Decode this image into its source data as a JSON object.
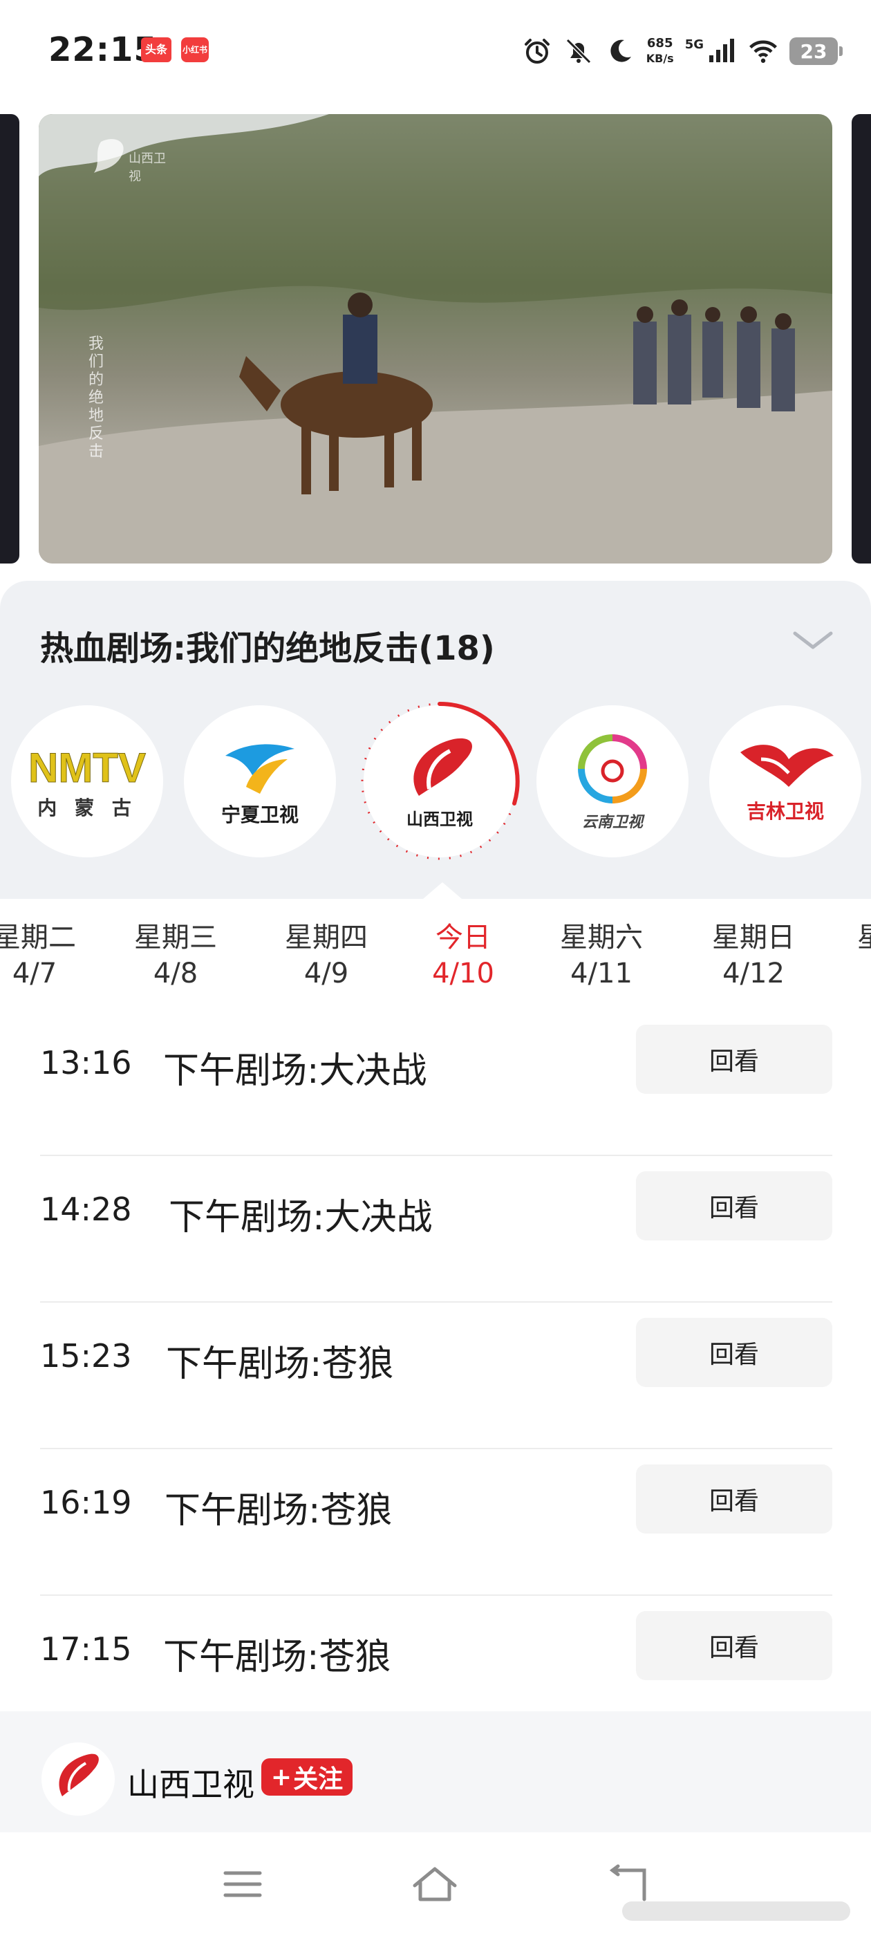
{
  "status_bar": {
    "time": "22:15",
    "badges": [
      "头条",
      "小红书"
    ],
    "network_speed": "685",
    "network_unit": "KB/s",
    "signal_label": "5G",
    "battery": "23",
    "icons": [
      "alarm-icon",
      "bell-muted-icon",
      "moon-icon",
      "signal-icon",
      "wifi-icon",
      "battery-icon"
    ]
  },
  "video": {
    "overlay_text": "我们的绝地反击",
    "watermark": "山西卫视"
  },
  "program": {
    "title": "热血剧场:我们的绝地反击(18)"
  },
  "channels": [
    {
      "name": "内蒙古",
      "logo_text": "NMTV",
      "label": "内 蒙 古"
    },
    {
      "name": "宁夏卫视",
      "label": "宁夏卫视"
    },
    {
      "name": "山西卫视",
      "label": "山西卫视",
      "active": true
    },
    {
      "name": "云南卫视",
      "label": "云南卫视"
    },
    {
      "name": "吉林卫视",
      "label": "吉林卫视"
    }
  ],
  "dates": [
    {
      "day": "星期二",
      "date": "4/7"
    },
    {
      "day": "星期三",
      "date": "4/8"
    },
    {
      "day": "星期四",
      "date": "4/9"
    },
    {
      "day": "今日",
      "date": "4/10",
      "active": true
    },
    {
      "day": "星期六",
      "date": "4/11"
    },
    {
      "day": "星期日",
      "date": "4/12"
    },
    {
      "day": "星",
      "date": ""
    }
  ],
  "schedule": [
    {
      "time": "13:16",
      "name": "下午剧场:大决战",
      "action": "回看"
    },
    {
      "time": "14:28",
      "name": "下午剧场:大决战",
      "action": "回看"
    },
    {
      "time": "15:23",
      "name": "下午剧场:苍狼",
      "action": "回看"
    },
    {
      "time": "16:19",
      "name": "下午剧场:苍狼",
      "action": "回看"
    },
    {
      "time": "17:15",
      "name": "下午剧场:苍狼",
      "action": "回看"
    }
  ],
  "channel_bar": {
    "name": "山西卫视",
    "follow_label": "关注",
    "follow_plus": "+"
  },
  "colors": {
    "accent": "#e2262b",
    "panel_bg": "#eff1f4"
  }
}
